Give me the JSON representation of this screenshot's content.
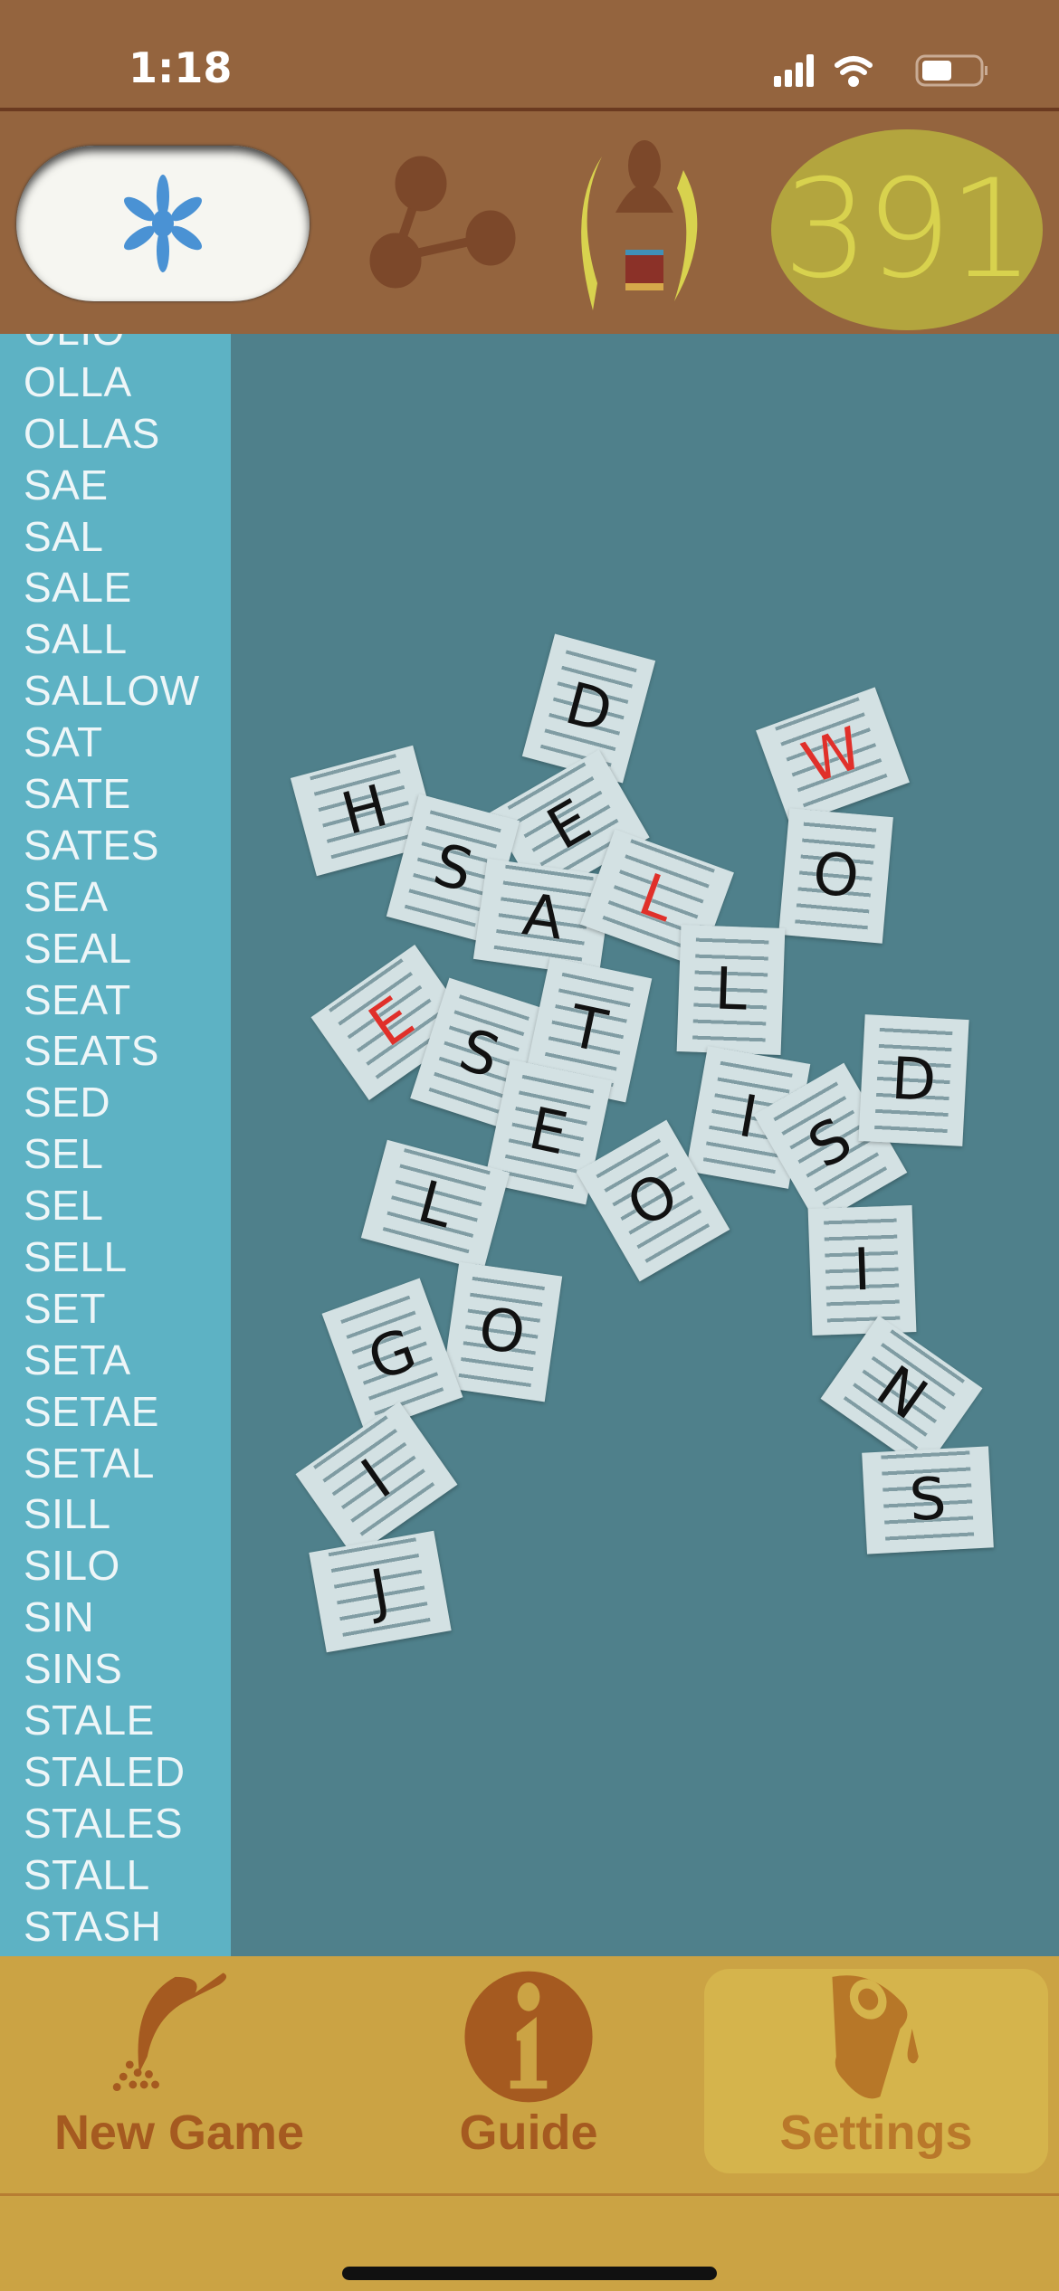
{
  "status_bar": {
    "time": "1:18",
    "icons": [
      "cellular-signal-icon",
      "wifi-icon",
      "battery-icon"
    ],
    "battery_level": 0.45
  },
  "header": {
    "hint_icon": "sparkle-flower-icon",
    "share_icon": "share-nodes-icon",
    "profile_icon": "player-laurel-icon",
    "score": "391"
  },
  "word_list": [
    "OLIO",
    "OLLA",
    "OLLAS",
    "SAE",
    "SAL",
    "SALE",
    "SALL",
    "SALLOW",
    "SAT",
    "SATE",
    "SATES",
    "SEA",
    "SEAL",
    "SEAT",
    "SEATS",
    "SED",
    "SEL",
    "SEL",
    "SELL",
    "SET",
    "SETA",
    "SETAE",
    "SETAL",
    "SILL",
    "SILO",
    "SIN",
    "SINS",
    "STALE",
    "STALED",
    "STALES",
    "STALL",
    "STASH"
  ],
  "tiles": [
    {
      "letter": "D",
      "color": "#111111"
    },
    {
      "letter": "W",
      "color": "#e0302a"
    },
    {
      "letter": "H",
      "color": "#111111"
    },
    {
      "letter": "E",
      "color": "#111111"
    },
    {
      "letter": "S",
      "color": "#111111"
    },
    {
      "letter": "A",
      "color": "#111111"
    },
    {
      "letter": "L",
      "color": "#e0302a"
    },
    {
      "letter": "O",
      "color": "#111111"
    },
    {
      "letter": "L",
      "color": "#111111"
    },
    {
      "letter": "E",
      "color": "#e0302a"
    },
    {
      "letter": "S",
      "color": "#111111"
    },
    {
      "letter": "T",
      "color": "#111111"
    },
    {
      "letter": "E",
      "color": "#111111"
    },
    {
      "letter": "I",
      "color": "#111111"
    },
    {
      "letter": "S",
      "color": "#111111"
    },
    {
      "letter": "D",
      "color": "#111111"
    },
    {
      "letter": "O",
      "color": "#111111"
    },
    {
      "letter": "L",
      "color": "#111111"
    },
    {
      "letter": "I",
      "color": "#111111"
    },
    {
      "letter": "O",
      "color": "#111111"
    },
    {
      "letter": "G",
      "color": "#111111"
    },
    {
      "letter": "N",
      "color": "#111111"
    },
    {
      "letter": "I",
      "color": "#111111"
    },
    {
      "letter": "S",
      "color": "#111111"
    },
    {
      "letter": "J",
      "color": "#111111"
    }
  ],
  "tabs": [
    {
      "label": "New Game",
      "icon": "scoop-beans-icon",
      "selected": false
    },
    {
      "label": "Guide",
      "icon": "info-icon",
      "selected": false
    },
    {
      "label": "Settings",
      "icon": "cup-icon",
      "selected": true
    }
  ],
  "colors": {
    "header": "#94643e",
    "sidebar": "#5db2c4",
    "board": "#4f808b",
    "tabbar": "#cba344",
    "score_bg": "#b3a53e",
    "accent_red": "#e0302a"
  }
}
